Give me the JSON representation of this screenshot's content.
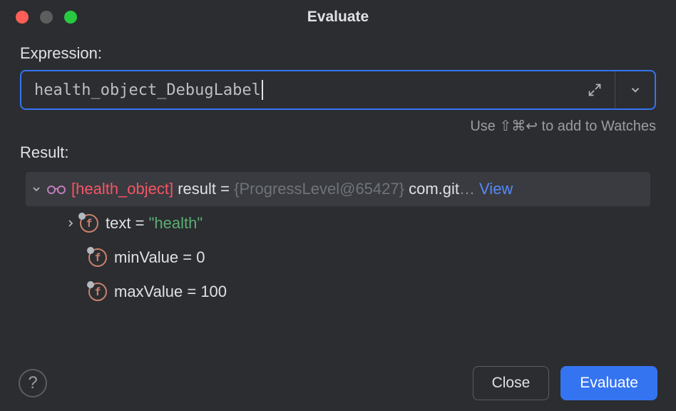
{
  "window": {
    "title": "Evaluate"
  },
  "expression": {
    "label": "Expression:",
    "value": "health_object_DebugLabel"
  },
  "hint": "Use ⇧⌘↩ to add to Watches",
  "result": {
    "label": "Result:",
    "root": {
      "labelName": "[health_object]",
      "varName": "result",
      "eq": "=",
      "typeValue": "{ProgressLevel@65427}",
      "pkgTruncated": "com.git",
      "viewLabel": "View"
    },
    "children": [
      {
        "name": "text",
        "eq": "=",
        "value": "\"health\"",
        "kind": "string",
        "expandable": true
      },
      {
        "name": "minValue",
        "eq": "=",
        "value": "0",
        "kind": "number",
        "expandable": false
      },
      {
        "name": "maxValue",
        "eq": "=",
        "value": "100",
        "kind": "number",
        "expandable": false
      }
    ]
  },
  "buttons": {
    "close": "Close",
    "evaluate": "Evaluate"
  }
}
